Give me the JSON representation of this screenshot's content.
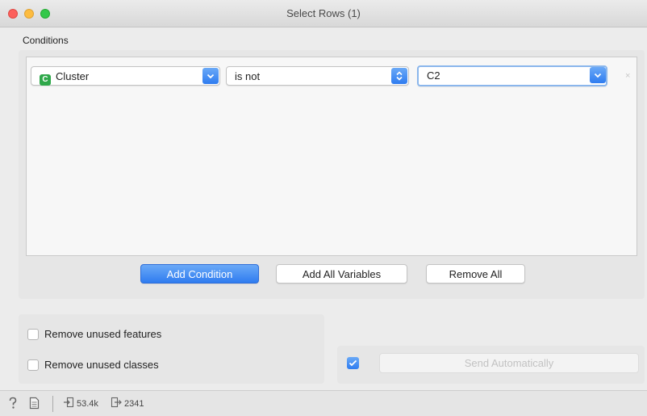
{
  "window": {
    "title": "Select Rows (1)",
    "accent_color": "#2f7cf0"
  },
  "conditions": {
    "label": "Conditions",
    "rows": [
      {
        "variable": "Cluster",
        "variable_type_badge": "C",
        "operator": "is not",
        "value": "C2"
      }
    ],
    "buttons": {
      "add_condition": "Add Condition",
      "add_all_variables": "Add All Variables",
      "remove_all": "Remove All"
    }
  },
  "options": {
    "remove_unused_features": {
      "label": "Remove unused features",
      "checked": false
    },
    "remove_unused_classes": {
      "label": "Remove unused classes",
      "checked": false
    }
  },
  "send": {
    "auto_checked": true,
    "label": "Send Automatically"
  },
  "status": {
    "input_count": "53.4k",
    "output_count": "2341"
  },
  "icons": {
    "help": "help-icon",
    "report": "report-icon",
    "input": "input-signal-icon",
    "output": "output-signal-icon"
  }
}
